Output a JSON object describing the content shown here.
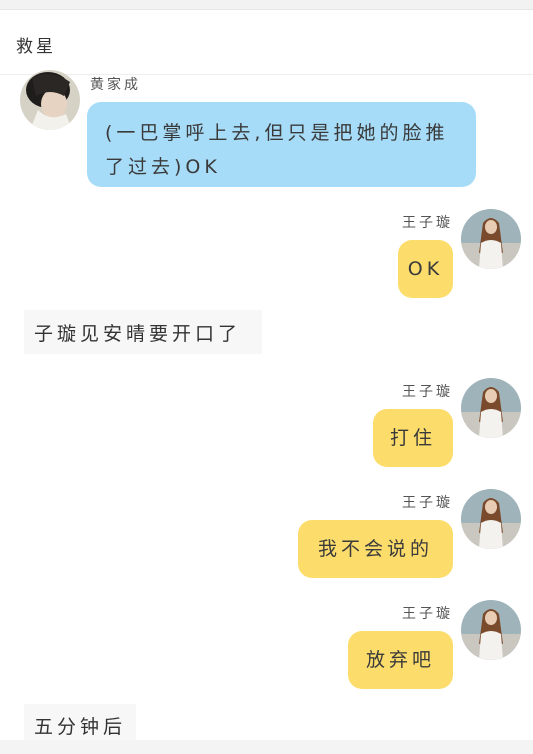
{
  "header": {
    "title": "救星"
  },
  "messages": [
    {
      "speaker": "黄家成",
      "text": "(一巴掌呼上去,但只是把她的脸推了过去)OK"
    },
    {
      "speaker": "王子璇",
      "text": "OK"
    },
    {
      "narration": "子璇见安晴要开口了"
    },
    {
      "speaker": "王子璇",
      "text": "打住"
    },
    {
      "speaker": "王子璇",
      "text": "我不会说的"
    },
    {
      "speaker": "王子璇",
      "text": "放弃吧"
    },
    {
      "narration": "五分钟后"
    }
  ],
  "colors": {
    "left_bubble": "#a6dcf8",
    "right_bubble": "#fcdd6c",
    "narration_bg": "#f7f7f7"
  },
  "icons": {
    "left_avatar": "avatar-dark-hair",
    "right_avatar": "avatar-long-hair-girl"
  }
}
